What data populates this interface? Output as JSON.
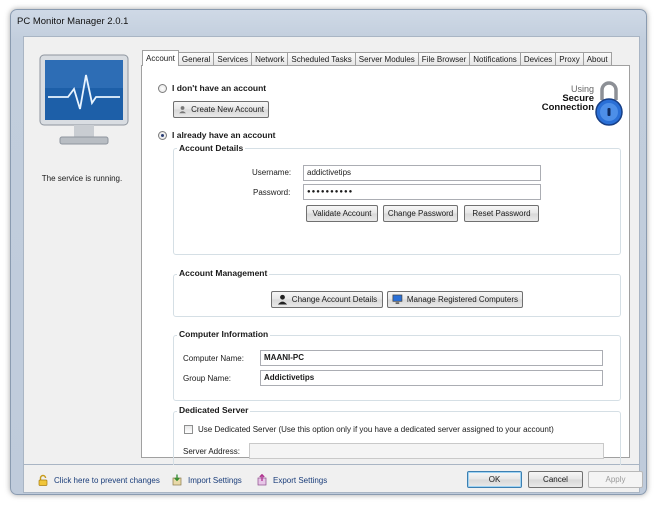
{
  "window": {
    "title": "PC Monitor Manager 2.0.1"
  },
  "status": {
    "text": "The service is running."
  },
  "tabs": [
    "Account",
    "General",
    "Services",
    "Network",
    "Scheduled Tasks",
    "Server Modules",
    "File Browser",
    "Notifications",
    "Devices",
    "Proxy",
    "About"
  ],
  "account": {
    "no_account_label": "I don't have an account",
    "create_account_label": "Create New Account",
    "have_account_label": "I already have an account",
    "secure_using": "Using",
    "secure_line1": "Secure",
    "secure_line2": "Connection",
    "details": {
      "title": "Account Details",
      "username_label": "Username:",
      "username_value": "addictivetips",
      "password_label": "Password:",
      "password_value": "●●●●●●●●●●",
      "validate_label": "Validate Account",
      "change_password_label": "Change Password",
      "reset_password_label": "Reset Password"
    },
    "management": {
      "title": "Account Management",
      "change_details_label": "Change Account Details",
      "manage_computers_label": "Manage Registered Computers"
    },
    "computer_info": {
      "title": "Computer Information",
      "computer_name_label": "Computer Name:",
      "computer_name_value": "MAANI-PC",
      "group_name_label": "Group Name:",
      "group_name_value": "Addictivetips"
    },
    "dedicated": {
      "title": "Dedicated Server",
      "checkbox_label": "Use Dedicated Server (Use this option only if you have a dedicated server assigned to your account)",
      "checked": false,
      "address_label": "Server Address:",
      "address_value": ""
    }
  },
  "footer": {
    "prevent_changes_label": "Click here to prevent changes",
    "import_label": "Import Settings",
    "export_label": "Export Settings",
    "ok_label": "OK",
    "cancel_label": "Cancel",
    "apply_label": "Apply"
  },
  "colors": {
    "accent": "#1f4f9e",
    "monitor_screen": "#1d5fa8",
    "lock_blue": "#2a6fd6"
  }
}
